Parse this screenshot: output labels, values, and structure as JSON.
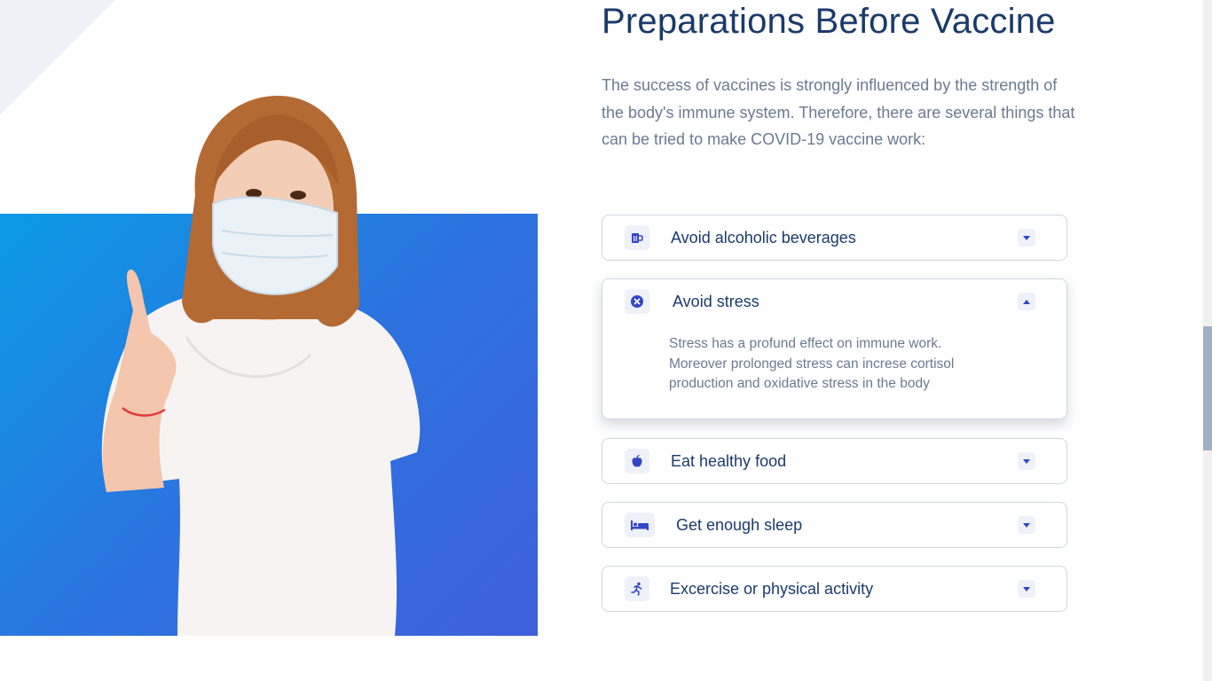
{
  "title": "Preparations Before Vaccine",
  "intro": "The success of vaccines is strongly influenced by the strength of the body's immune system. Therefore, there are several things that can be tried to make COVID-19 vaccine work:",
  "colors": {
    "accent": "#3346c8",
    "heading": "#1b3a6b",
    "hero_from": "#0b9be6",
    "hero_to": "#3f5fdc"
  },
  "hero_image": "woman-wearing-face-mask-pointing-up",
  "accordion": [
    {
      "label": "Avoid alcoholic beverages",
      "icon": "beer-mug-icon",
      "state": "collapsed"
    },
    {
      "label": "Avoid stress",
      "icon": "close-circle-icon",
      "state": "expanded",
      "body": "Stress has a profund effect on immune work. Moreover prolonged stress can increse cortisol production and oxidative stress in the body"
    },
    {
      "label": "Eat healthy food",
      "icon": "apple-icon",
      "state": "collapsed"
    },
    {
      "label": "Get enough sleep",
      "icon": "bed-icon",
      "state": "collapsed"
    },
    {
      "label": "Excercise or physical activity",
      "icon": "running-person-icon",
      "state": "collapsed"
    }
  ]
}
